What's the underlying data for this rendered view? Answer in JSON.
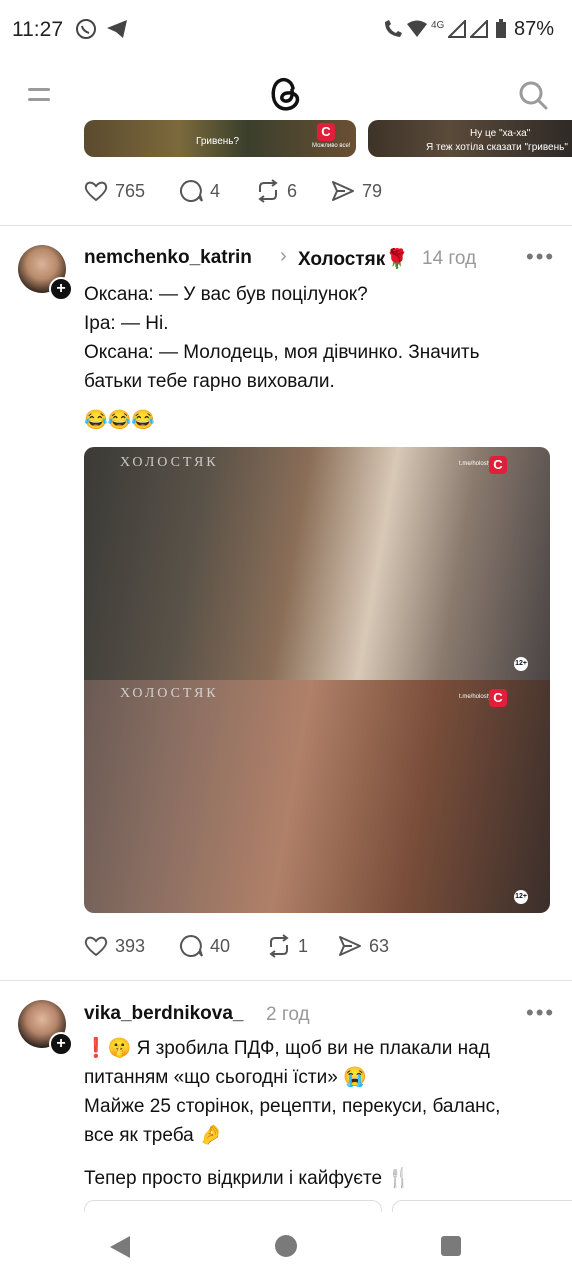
{
  "status_bar": {
    "time": "11:27",
    "network": "4G",
    "battery": "87%"
  },
  "top_post": {
    "thumb1_caption": "Гривень?",
    "thumb1_caption2": "Можливо все!",
    "thumb2_caption": "Ну це \"ха-ха\"",
    "thumb2_caption2": "Я теж хотіла сказати \"гривень\"",
    "channel_logo": "С",
    "likes": "765",
    "comments": "4",
    "reposts": "6",
    "shares": "79"
  },
  "post1": {
    "username": "nemchenko_katrin",
    "community": "Холостяк🌹",
    "time": "14 год",
    "lines": [
      "Оксана: — У вас був поцілунок?",
      "Іра: — Ні.",
      "Оксана: — Молодець, моя дівчинко. Значить",
      "батьки тебе гарно виховали."
    ],
    "emoji_line": "😂😂😂",
    "watermark": "ХОЛОСТЯК",
    "channel_logo": "С",
    "site": "t.me/holostyakua",
    "age_rating": "12+",
    "likes": "393",
    "comments": "40",
    "reposts": "1",
    "shares": "63"
  },
  "post2": {
    "username": "vika_berdnikova_",
    "time": "2 год",
    "lines": [
      "❗🤫 Я зробила ПДФ, щоб ви не плакали над",
      "питанням «що сьогодні їсти» 😭",
      "Майже 25 сторінок, рецепти, перекуси, баланс,",
      "все як треба 🤌"
    ],
    "last_line": "Тепер просто відкрили і кайфуєте 🍴"
  },
  "icons": {
    "menu": "menu-icon",
    "logo": "threads-logo-icon",
    "search": "search-icon",
    "like": "heart-icon",
    "comment": "comment-icon",
    "repost": "repost-icon",
    "share": "share-icon",
    "more": "more-icon"
  },
  "colors": {
    "channel_red": "#e21f3a",
    "muted": "#999999",
    "nav_gray": "#7a7a7a"
  }
}
